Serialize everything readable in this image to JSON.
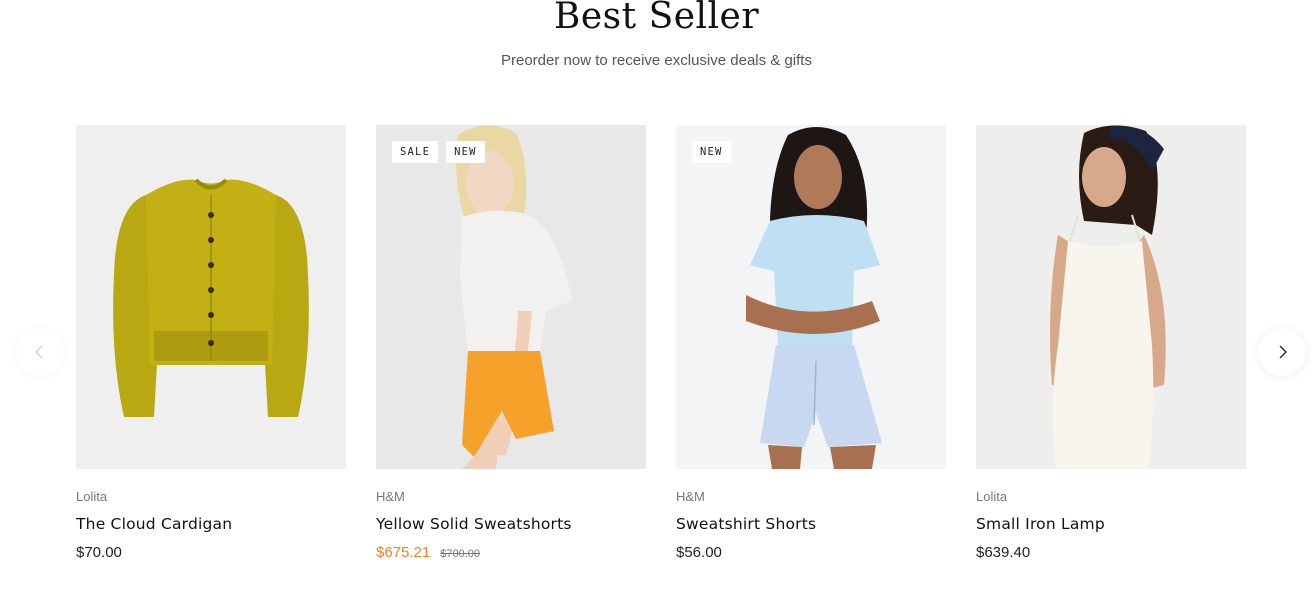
{
  "section": {
    "title": "Best Seller",
    "subtitle": "Preorder now to receive exclusive deals & gifts"
  },
  "carousel": {
    "prev_icon": "chevron-left-icon",
    "next_icon": "chevron-right-icon"
  },
  "products": [
    {
      "vendor": "Lolita",
      "title": "The Cloud Cardigan",
      "price": "$70.00",
      "compare_price": "",
      "badges": [],
      "image": "yellow-knit-cardigan"
    },
    {
      "vendor": "H&M",
      "title": "Yellow Solid Sweatshorts",
      "price": "$675.21",
      "compare_price": "$700.00",
      "badges": [
        "SALE",
        "NEW"
      ],
      "image": "model-white-tee-orange-shorts"
    },
    {
      "vendor": "H&M",
      "title": "Sweatshirt Shorts",
      "price": "$56.00",
      "compare_price": "",
      "badges": [
        "NEW"
      ],
      "image": "model-blue-tee-light-blue-shorts"
    },
    {
      "vendor": "Lolita",
      "title": "Small Iron Lamp",
      "price": "$639.40",
      "compare_price": "",
      "badges": [],
      "image": "model-white-slip-dress"
    }
  ],
  "colors": {
    "sale_price": "#e8843a",
    "text": "#111111",
    "muted": "#777777"
  }
}
